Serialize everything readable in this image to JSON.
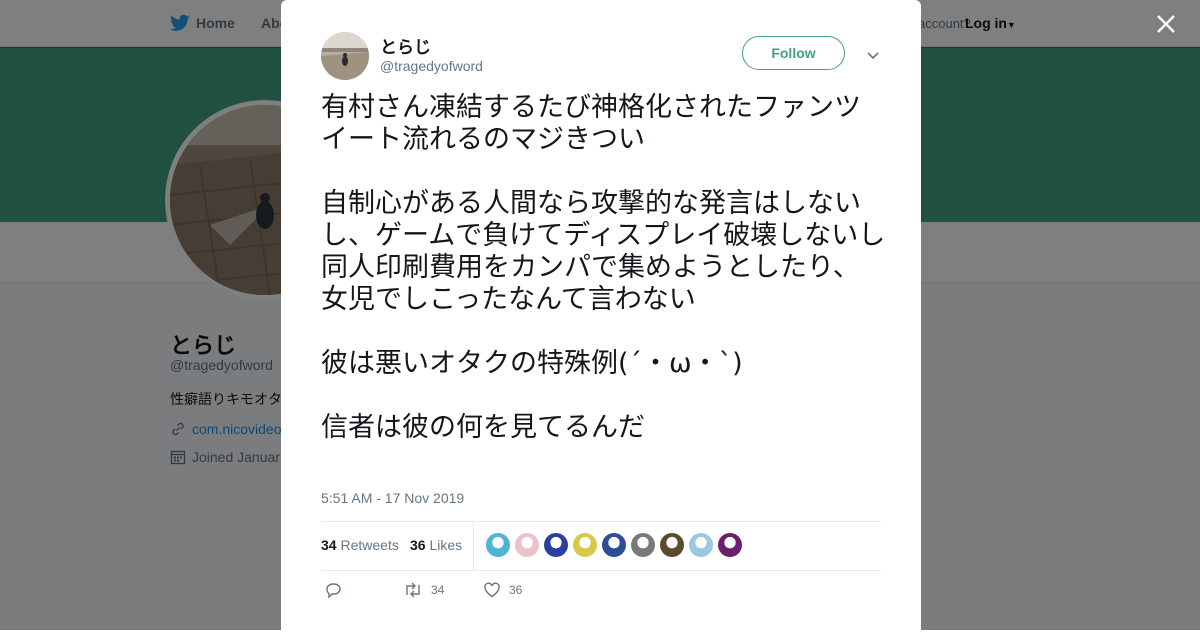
{
  "background": {
    "nav": {
      "home_label": "Home",
      "about_label": "Abo",
      "account_prompt": "account?",
      "login_label": "Log in"
    },
    "profile": {
      "name": "とらじ",
      "handle": "@tragedyofword",
      "bio": "性癖語りキモオタ",
      "link": "com.nicovideo",
      "joined": "Joined Januar"
    },
    "colors": {
      "banner": "#40a281",
      "overlay": "rgba(0,0,0,0.5)"
    }
  },
  "tweet": {
    "author": {
      "name": "とらじ",
      "handle": "@tragedyofword"
    },
    "follow_label": "Follow",
    "text": "有村さん凍結するたび神格化されたファンツイート流れるのマジきつい\n\n自制心がある人間なら攻撃的な発言はしないし、ゲームで負けてディスプレイ破壊しないし\n同人印刷費用をカンパで集めようとしたり、女児でしこったなんて言わない\n\n彼は悪いオタクの特殊例(´・ω・`)\n\n信者は彼の何を見てるんだ",
    "timestamp": "5:51 AM - 17 Nov 2019",
    "retweets_count": "34",
    "retweets_label": "Retweets",
    "likes_count": "36",
    "likes_label": "Likes",
    "action_retweet_count": "34",
    "action_like_count": "36",
    "liker_colors": [
      "#4fb3d6",
      "#e8c4c8",
      "#2a3fa0",
      "#d9c94a",
      "#2c4f9a",
      "#7a7a7a",
      "#5a4a2e",
      "#9cc7e0",
      "#6b1f6e"
    ],
    "accent_color": "#40a281"
  },
  "icons": {
    "bird": "twitter-bird-icon",
    "close": "close-icon",
    "caret": "chevron-down-icon",
    "reply": "reply-icon",
    "retweet": "retweet-icon",
    "like": "heart-icon",
    "link": "link-icon",
    "calendar": "calendar-icon"
  }
}
